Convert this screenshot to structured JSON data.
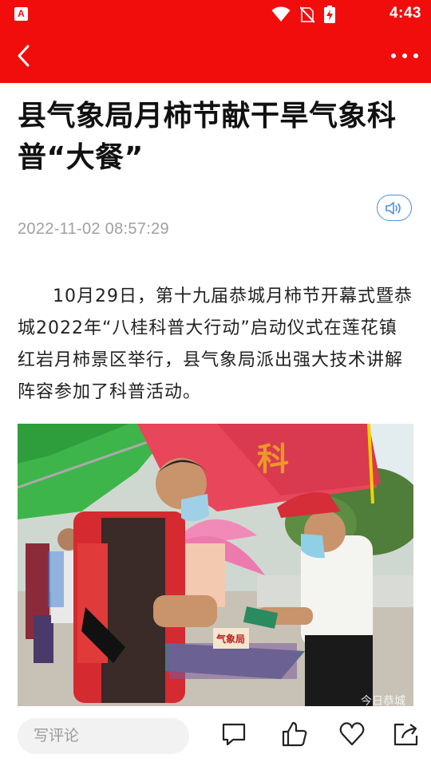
{
  "status_bar": {
    "app_icon_letter": "A",
    "time": "4:43"
  },
  "nav": {
    "back_icon": "back-chevron-icon",
    "more_icon": "more-dots-icon"
  },
  "article": {
    "title": "县气象局月柿节献干旱气象科普“大餐”",
    "audio_icon": "speaker-icon",
    "date": "2022-11-02 08:57:29",
    "paragraph": "10月29日，第十九届恭城月柿节开幕式暨恭城2022年“八桂科普大行动”启动仪式在莲花镇红岩月柿景区举行，县气象局派出强大技术讲解阵容参加了科普活动。",
    "photo": {
      "desk_sign": "气象局",
      "watermark": "今日恭城"
    }
  },
  "bottom_bar": {
    "comment_placeholder": "写评论",
    "icons": [
      "comment-icon",
      "thumbs-up-icon",
      "heart-icon",
      "share-icon"
    ]
  },
  "colors": {
    "brand_red": "#f20d0d",
    "accent_blue": "#4a90e2"
  }
}
